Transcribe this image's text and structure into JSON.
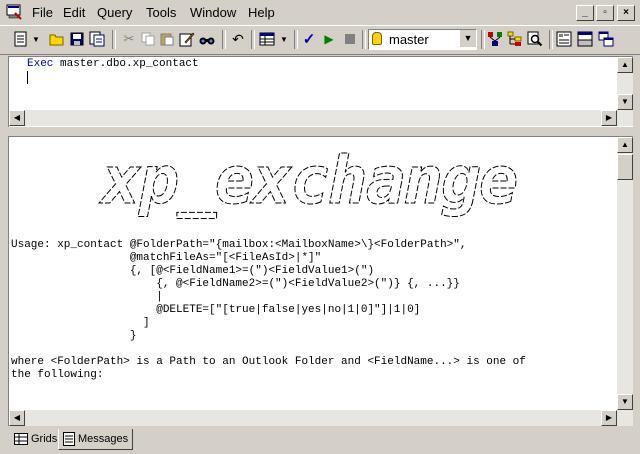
{
  "menu": {
    "items": [
      "File",
      "Edit",
      "Query",
      "Tools",
      "Window",
      "Help"
    ],
    "window_buttons": {
      "minimize": "_",
      "restore": "▫",
      "close": "×"
    }
  },
  "toolbar": {
    "database": "master"
  },
  "editor": {
    "keyword": "Exec",
    "command": " master.dbo.xp_contact"
  },
  "results": {
    "banner_text": "xp_exchange",
    "lines": [
      "Usage: xp_contact @FolderPath=\"{mailbox:<MailboxName>\\}<FolderPath>\",",
      "                  @matchFileAs=\"[<FileAsId>|*]\"",
      "                  {, [@<FieldName1>=(\")<FieldValue1>(\")",
      "                      {, @<FieldName2>=(\")<FieldValue2>(\")} {, ...}}",
      "                      |",
      "                      @DELETE=[\"[true|false|yes|no|1|0]\"]|1|0]",
      "                    ]",
      "                  }",
      "",
      "where <FolderPath> is a Path to an Outlook Folder and <FieldName...> is one of",
      "the following:"
    ]
  },
  "tabs": {
    "grids": "Grids",
    "messages": "Messages"
  }
}
